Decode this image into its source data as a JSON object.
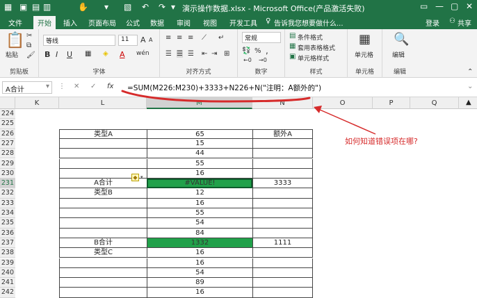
{
  "title": "演示操作数据.xlsx - Microsoft Office(产品激活失败)",
  "account": {
    "login": "登录",
    "share": "共享"
  },
  "tabs": [
    "文件",
    "开始",
    "插入",
    "页面布局",
    "公式",
    "数据",
    "审阅",
    "视图",
    "开发工具"
  ],
  "active_tab": "开始",
  "tell_me": "告诉我您想要做什么...",
  "ribbon": {
    "clipboard": {
      "paste": "粘贴",
      "label": "剪贴板"
    },
    "font": {
      "name": "等线",
      "size": "11",
      "bold": "B",
      "italic": "I",
      "underline": "U",
      "grow": "A",
      "shrink": "A",
      "color": "A",
      "wen": "wén",
      "label": "字体"
    },
    "align": {
      "label": "对齐方式"
    },
    "number": {
      "format": "常规",
      "pct": "%",
      "comma": ",",
      "label": "数字"
    },
    "styles": {
      "cond": "条件格式",
      "table": "套用表格格式",
      "cell": "单元格样式",
      "label": "样式"
    },
    "cells": {
      "btn": "单元格",
      "label": "单元格"
    },
    "edit": {
      "btn": "编辑",
      "label": "编辑"
    }
  },
  "namebox": "A合计",
  "formula_buttons": {
    "cancel": "✕",
    "enter": "✓",
    "fx": "fx"
  },
  "formula": "=SUM(M226:M230)+3333+N226+N(\"注明：A额外的\")",
  "columns": [
    "K",
    "L",
    "M",
    "N",
    "O",
    "P",
    "Q"
  ],
  "selected_column": "M",
  "rows": [
    {
      "r": "224",
      "L": "",
      "M": "",
      "N": ""
    },
    {
      "r": "225",
      "L": "",
      "M": "",
      "N": ""
    },
    {
      "r": "226",
      "L": "类型A",
      "M": "65",
      "N": "额外A"
    },
    {
      "r": "227",
      "L": "",
      "M": "15",
      "N": ""
    },
    {
      "r": "228",
      "L": "",
      "M": "44",
      "N": ""
    },
    {
      "r": "229",
      "L": "",
      "M": "55",
      "N": ""
    },
    {
      "r": "230",
      "L": "",
      "M": "16",
      "N": ""
    },
    {
      "r": "231",
      "L": "A合计",
      "M": "#VALUE!",
      "N": "3333"
    },
    {
      "r": "232",
      "L": "类型B",
      "M": "12",
      "N": ""
    },
    {
      "r": "233",
      "L": "",
      "M": "16",
      "N": ""
    },
    {
      "r": "234",
      "L": "",
      "M": "55",
      "N": ""
    },
    {
      "r": "235",
      "L": "",
      "M": "54",
      "N": ""
    },
    {
      "r": "236",
      "L": "",
      "M": "84",
      "N": ""
    },
    {
      "r": "237",
      "L": "B合计",
      "M": "1332",
      "N": "1111"
    },
    {
      "r": "238",
      "L": "类型C",
      "M": "16",
      "N": ""
    },
    {
      "r": "239",
      "L": "",
      "M": "16",
      "N": ""
    },
    {
      "r": "240",
      "L": "",
      "M": "54",
      "N": ""
    },
    {
      "r": "241",
      "L": "",
      "M": "89",
      "N": ""
    },
    {
      "r": "242",
      "L": "",
      "M": "16",
      "N": ""
    }
  ],
  "selected_row": "231",
  "annotation": "如何知道错误项在哪?",
  "colors": {
    "excel_green": "#217346",
    "highlight": "#21a14a",
    "annot_red": "#d62b2b"
  }
}
